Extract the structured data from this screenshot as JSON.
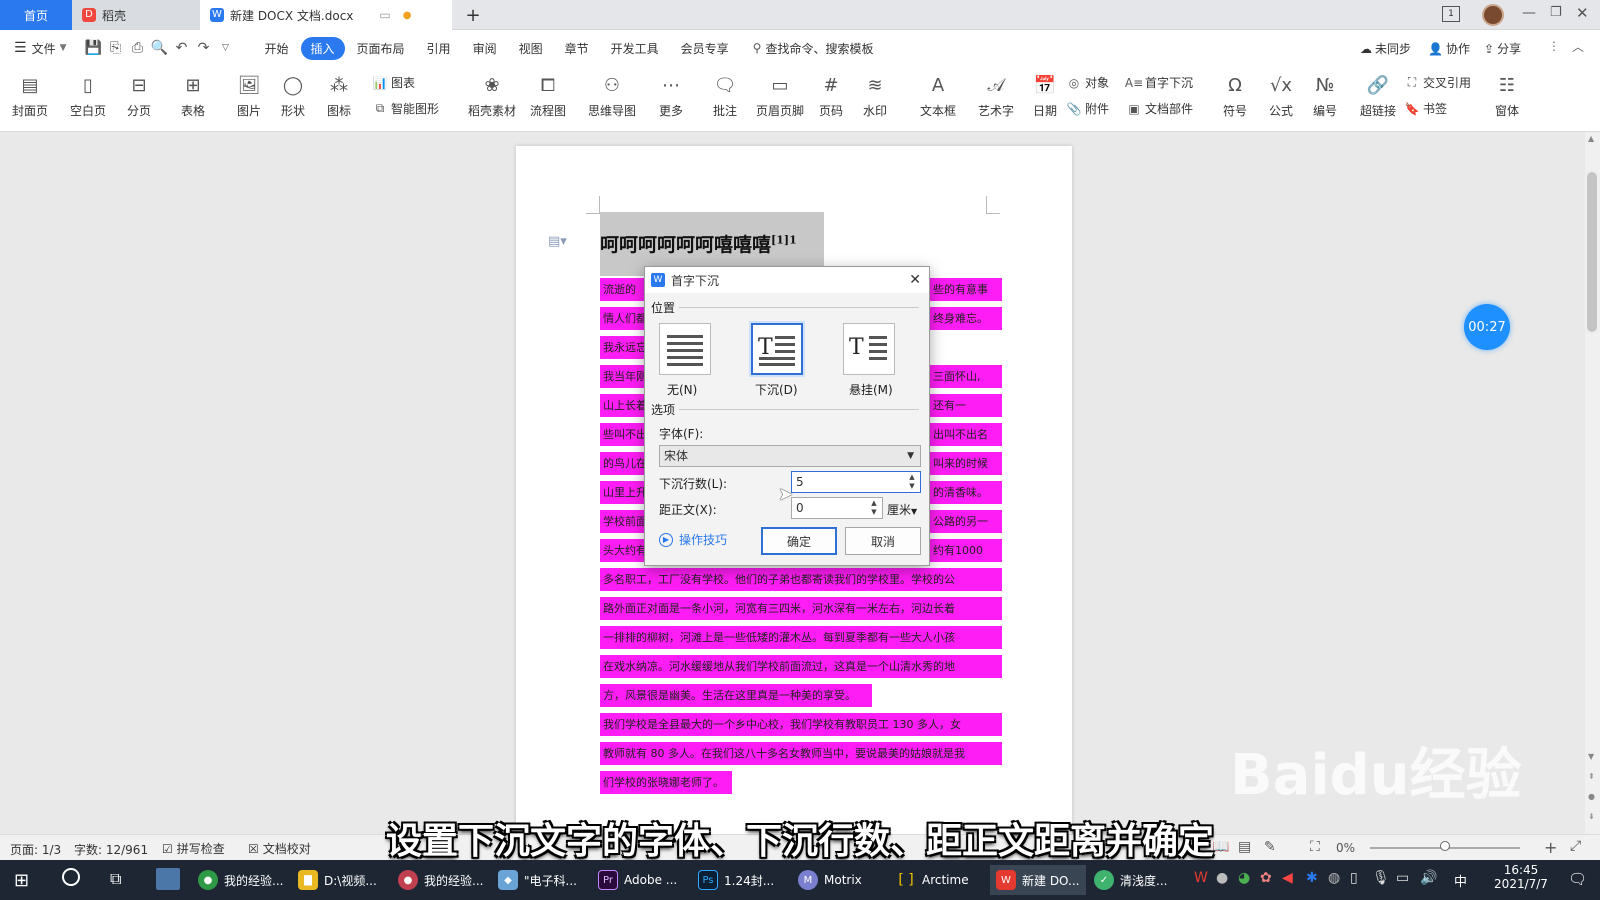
{
  "tabs": {
    "home": "首页",
    "docer": "稻壳",
    "doc": "新建 DOCX 文档.docx",
    "new_tab": "+"
  },
  "menu": {
    "file": "文件",
    "items": [
      "开始",
      "插入",
      "页面布局",
      "引用",
      "审阅",
      "视图",
      "章节",
      "开发工具",
      "会员专享"
    ],
    "search": "查找命令、搜索模板",
    "sync": "未同步",
    "collab": "协作",
    "share": "分享"
  },
  "ribbon": {
    "cover": "封面页",
    "blank": "空白页",
    "pagebreak": "分页",
    "table": "表格",
    "picture": "图片",
    "shape": "形状",
    "iconlib": "图标",
    "chart": "图表",
    "smartart": "智能图形",
    "docer_material": "稻壳素材",
    "flowchart": "流程图",
    "mindmap": "思维导图",
    "more": "更多",
    "comment": "批注",
    "header_footer": "页眉页脚",
    "page_number": "页码",
    "watermark": "水印",
    "textbox": "文本框",
    "wordart": "艺术字",
    "date": "日期",
    "object": "对象",
    "attachment": "附件",
    "dropcap": "首字下沉",
    "docparts": "文档部件",
    "symbol": "符号",
    "formula": "公式",
    "numbering": "编号",
    "hyperlink": "超链接",
    "crossref": "交叉引用",
    "bookmark": "书签",
    "window": "窗体"
  },
  "document": {
    "title": "呵呵呵呵呵呵嘻嘻嘻",
    "title_ref": "[1]1",
    "left_fragments": [
      "流逝的",
      "情人们都",
      "我永远忘",
      "我当年刚",
      "山上长着",
      "些叫不出",
      "的鸟儿在",
      "山里上升",
      "学校前面",
      "头大约有"
    ],
    "right_fragments": [
      "些的有意事",
      "终身难忘。",
      "",
      "三面怀山,",
      "还有一",
      "出叫不出名",
      "叫来的时候",
      "的清香味。",
      "公路的另一",
      "约有1000"
    ],
    "lines": [
      "多名职工，工厂没有学校。他们的子弟也都寄读我们的学校里。学校的公",
      "路外面正对面是一条小河，河宽有三四米，河水深有一米左右，河边长着",
      "一排排的柳树，河滩上是一些低矮的灌木丛。每到夏季都有一些大人小孩",
      "在戏水纳凉。河水缓缓地从我们学校前面流过，这真是一个山清水秀的地",
      "方，风景很是幽美。生活在这里真是一种美的享受。",
      "我们学校是全县最大的一个乡中心校，我们学校有教职员工 130 多人，女",
      "教师就有 80 多人。在我们这八十多名女教师当中，要说最美的姑娘就是我",
      "们学校的张晓娜老师了。"
    ]
  },
  "dialog": {
    "title": "首字下沉",
    "position_label": "位置",
    "opt_none": "无(N)",
    "opt_drop": "下沉(D)",
    "opt_margin": "悬挂(M)",
    "options_label": "选项",
    "font_label": "字体(F):",
    "font_value": "宋体",
    "lines_label": "下沉行数(L):",
    "lines_value": "5",
    "distance_label": "距正文(X):",
    "distance_value": "0",
    "unit": "厘米",
    "tips": "操作技巧",
    "ok": "确定",
    "cancel": "取消"
  },
  "status": {
    "page": "页面: 1/3",
    "words": "字数: 12/961",
    "spellcheck": "拼写检查",
    "proof": "文档校对",
    "zoom": "0%"
  },
  "timer": "00:27",
  "subtitle": "设置下沉文字的字体、下沉行数、距正文距离并确定",
  "watermark_text": "Baidu经验",
  "taskbar": {
    "items": [
      "我的经验...",
      "D:\\视频...",
      "我的经验...",
      "\"电子科...",
      "Adobe ...",
      "1.24封...",
      "Motrix",
      "Arctime",
      "新建 DO...",
      "清浅度..."
    ],
    "lang": "中",
    "time": "16:45",
    "date": "2021/7/7"
  },
  "colors": {
    "highlight": "#ff1df5",
    "accent": "#2b79ee",
    "taskbar": "#1d2632"
  }
}
